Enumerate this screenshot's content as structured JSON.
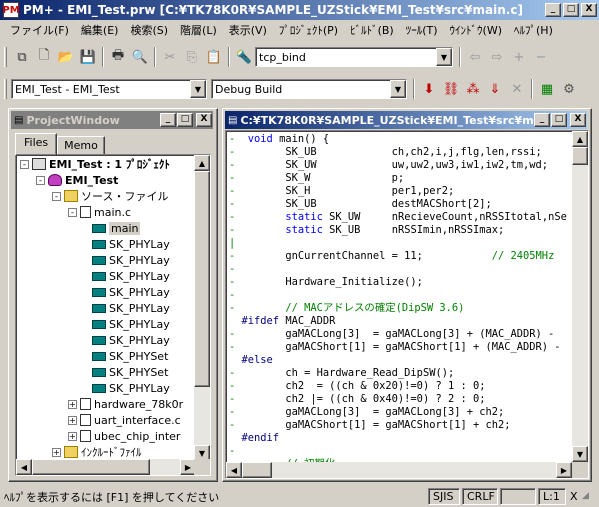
{
  "window": {
    "title": "PM+ - EMI_Test.prw [C:¥TK78K0R¥SAMPLE_UZStick¥EMI_Test¥src¥main.c]",
    "app_icon": "PM",
    "min_label": "_",
    "max_label": "□",
    "close_label": "X"
  },
  "menu": [
    "ファイル(F)",
    "編集(E)",
    "検索(S)",
    "階層(L)",
    "表示(V)",
    "ﾌﾟﾛｼﾞｪｸﾄ(P)",
    "ﾋﾞﾙﾄﾞ(B)",
    "ﾂｰﾙ(T)",
    "ｳｲﾝﾄﾞｳ(W)",
    "ﾍﾙﾌﾟ(H)"
  ],
  "toolbar1": {
    "search_value": "tcp_bind"
  },
  "toolbar2": {
    "project_combo": "EMI_Test - EMI_Test",
    "build_combo": "Debug Build"
  },
  "project_window": {
    "title": "ProjectWindow",
    "tabs": [
      "Files",
      "Memo"
    ],
    "tree": [
      {
        "label": "EMI_Test : 1 ﾌﾟﾛｼﾞｪｸﾄ",
        "icon": "workspace-icon",
        "pm": "-",
        "bold": true
      },
      {
        "label": "EMI_Test",
        "icon": "project-icon",
        "pm": "-",
        "bold": true
      },
      {
        "label": "ソース・ファイル",
        "icon": "folder-icon",
        "pm": "-"
      },
      {
        "label": "main.c",
        "icon": "source-file-icon",
        "pm": "-"
      },
      {
        "label": "main",
        "icon": "function-icon",
        "selected": true
      },
      {
        "label": "SK_PHYLay",
        "icon": "function-icon"
      },
      {
        "label": "SK_PHYLay",
        "icon": "function-icon"
      },
      {
        "label": "SK_PHYLay",
        "icon": "function-icon"
      },
      {
        "label": "SK_PHYLay",
        "icon": "function-icon"
      },
      {
        "label": "SK_PHYLay",
        "icon": "function-icon"
      },
      {
        "label": "SK_PHYLay",
        "icon": "function-icon"
      },
      {
        "label": "SK_PHYLay",
        "icon": "function-icon"
      },
      {
        "label": "SK_PHYSet",
        "icon": "function-icon"
      },
      {
        "label": "SK_PHYSet",
        "icon": "function-icon"
      },
      {
        "label": "SK_PHYLay",
        "icon": "function-icon"
      },
      {
        "label": "hardware_78k0r",
        "icon": "source-file-icon",
        "pm": "+"
      },
      {
        "label": "uart_interface.c",
        "icon": "source-file-icon",
        "pm": "+"
      },
      {
        "label": "ubec_chip_inter",
        "icon": "source-file-icon",
        "pm": "+"
      },
      {
        "label": "ｲﾝｸﾙｰﾄﾞﾌｧｲﾙ",
        "icon": "folder-icon",
        "pm": "+"
      }
    ]
  },
  "editor": {
    "title": "C:¥TK78K0R¥SAMPLE_UZStick¥EMI_Test¥src¥ma",
    "lines": [
      {
        "g": "-",
        "parts": [
          [
            "kw",
            "void"
          ],
          [
            "t",
            " main() {"
          ]
        ]
      },
      {
        "g": "-",
        "parts": [
          [
            "t",
            "      SK_UB            ch,ch2,i,j,flg,len,rssi;"
          ]
        ]
      },
      {
        "g": "-",
        "parts": [
          [
            "t",
            "      SK_UW            uw,uw2,uw3,iw1,iw2,tm,wd;"
          ]
        ]
      },
      {
        "g": "-",
        "parts": [
          [
            "t",
            "      SK_W             p;"
          ]
        ]
      },
      {
        "g": "-",
        "parts": [
          [
            "t",
            "      SK_H             per1,per2;"
          ]
        ]
      },
      {
        "g": "-",
        "parts": [
          [
            "t",
            "      SK_UB            destMACShort[2];"
          ]
        ]
      },
      {
        "g": "-",
        "parts": [
          [
            "t",
            "      "
          ],
          [
            "kw",
            "static"
          ],
          [
            "t",
            " SK_UW     nRecieveCount,nRSSItotal,nSe"
          ]
        ]
      },
      {
        "g": "-",
        "parts": [
          [
            "t",
            "      "
          ],
          [
            "kw",
            "static"
          ],
          [
            "t",
            " SK_UB     nRSSImin,nRSSImax;"
          ]
        ]
      },
      {
        "g": "|",
        "parts": [
          [
            "t",
            ""
          ]
        ]
      },
      {
        "g": "-",
        "parts": [
          [
            "t",
            "      gnCurrentChannel = 11;           "
          ],
          [
            "cm",
            "// 2405MHz"
          ]
        ]
      },
      {
        "g": "-",
        "parts": [
          [
            "t",
            ""
          ]
        ]
      },
      {
        "g": "-",
        "parts": [
          [
            "t",
            "      Hardware_Initialize();"
          ]
        ]
      },
      {
        "g": "-",
        "parts": [
          [
            "t",
            ""
          ]
        ]
      },
      {
        "g": "-",
        "parts": [
          [
            "t",
            "      "
          ],
          [
            "cm",
            "// MACアドレスの確定(DipSW 3.6)"
          ]
        ]
      },
      {
        "g": "",
        "parts": [
          [
            "pp",
            "#ifdef"
          ],
          [
            "t",
            " MAC_ADDR"
          ]
        ]
      },
      {
        "g": "-",
        "parts": [
          [
            "t",
            "      gaMACLong[3]  = gaMACLong[3] + (MAC_ADDR) -"
          ]
        ]
      },
      {
        "g": "-",
        "parts": [
          [
            "t",
            "      gaMACShort[1] = gaMACShort[1] + (MAC_ADDR) -"
          ]
        ]
      },
      {
        "g": "",
        "parts": [
          [
            "pp",
            "#else"
          ]
        ]
      },
      {
        "g": "-",
        "parts": [
          [
            "t",
            "      ch = Hardware_Read_DipSW();"
          ]
        ]
      },
      {
        "g": "-",
        "parts": [
          [
            "t",
            "      ch2  = ((ch & 0x20)!=0) ? 1 : 0;"
          ]
        ]
      },
      {
        "g": "-",
        "parts": [
          [
            "t",
            "      ch2 |= ((ch & 0x40)!=0) ? 2 : 0;"
          ]
        ]
      },
      {
        "g": "-",
        "parts": [
          [
            "t",
            "      gaMACLong[3]  = gaMACLong[3] + ch2;"
          ]
        ]
      },
      {
        "g": "-",
        "parts": [
          [
            "t",
            "      gaMACShort[1] = gaMACShort[1] + ch2;"
          ]
        ]
      },
      {
        "g": "",
        "parts": [
          [
            "pp",
            "#endif"
          ]
        ]
      },
      {
        "g": "-",
        "parts": [
          [
            "t",
            ""
          ]
        ]
      },
      {
        "g": "-",
        "parts": [
          [
            "t",
            "      "
          ],
          [
            "cm",
            "// 初期化"
          ]
        ]
      }
    ]
  },
  "status": {
    "help": "ﾍﾙﾌﾟを表示するには [F1] を押してください",
    "encoding": "SJIS",
    "line_ending": "CRLF",
    "position": "L:1",
    "extra": "X"
  }
}
